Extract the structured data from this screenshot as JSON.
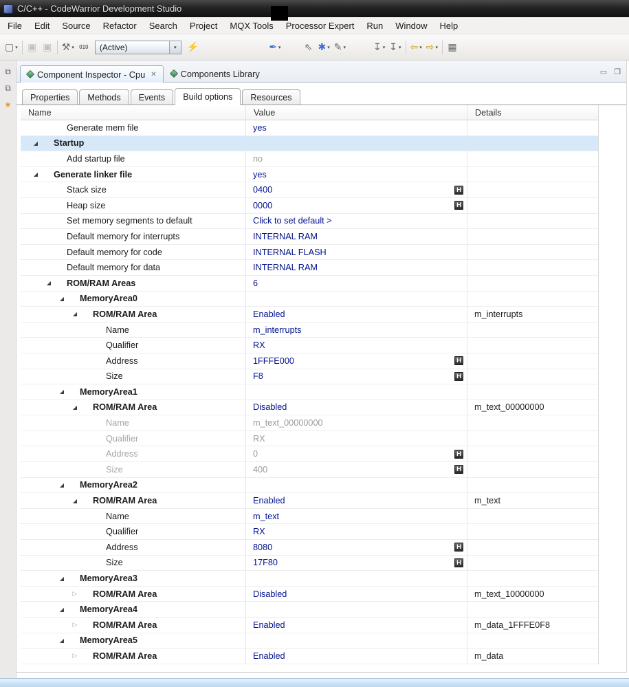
{
  "window": {
    "title": "C/C++ - CodeWarrior Development Studio"
  },
  "menu": {
    "items": [
      "File",
      "Edit",
      "Source",
      "Refactor",
      "Search",
      "Project",
      "MQX Tools",
      "Processor Expert",
      "Run",
      "Window",
      "Help"
    ]
  },
  "toolbar": {
    "active_combo": "(Active)",
    "caret_glyph": "▾",
    "items": [
      {
        "name": "new-wizard-button",
        "glyph": "▢",
        "caret": true
      },
      {
        "sep": true
      },
      {
        "name": "save-button",
        "glyph": "▣",
        "disabled": true
      },
      {
        "name": "save-all-button",
        "glyph": "▣",
        "disabled": true
      },
      {
        "sep": true
      },
      {
        "name": "build-settings-button",
        "glyph": "⚒",
        "caret": true
      },
      {
        "name": "binary-file-button",
        "glyph": "010",
        "small": true
      },
      {
        "name": "build-config-combo",
        "combo": true
      },
      {
        "name": "flash-programmer-button",
        "glyph": "⚡",
        "color": "#b8860b"
      },
      {
        "gap": 96
      },
      {
        "name": "debug-quill-button",
        "glyph": "✒",
        "color": "#3a6fd8",
        "caret": true
      },
      {
        "gap": 26
      },
      {
        "name": "select-tool-button",
        "glyph": "⇖"
      },
      {
        "name": "processor-expert-refresh-button",
        "glyph": "✱",
        "color": "#3a6fd8",
        "caret": true
      },
      {
        "name": "edit-pencil-button",
        "glyph": "✎",
        "caret": true
      },
      {
        "gap": 34
      },
      {
        "name": "run-to-line-button",
        "glyph": "↧",
        "caret": true
      },
      {
        "name": "instruction-step-button",
        "glyph": "↧",
        "caret": true
      },
      {
        "sep": true
      },
      {
        "name": "back-button",
        "glyph": "⇦",
        "color": "#c9a227",
        "caret": true
      },
      {
        "name": "forward-button",
        "glyph": "⇨",
        "color": "#c9a227",
        "caret": true
      },
      {
        "sep": true
      },
      {
        "name": "pin-editor-button",
        "glyph": "▦"
      }
    ]
  },
  "fastview": {
    "icons": [
      {
        "name": "restore-view-icon",
        "glyph": "⧉",
        "color": "#5a6b7c"
      },
      {
        "name": "open-perspective-icon",
        "glyph": "⧉",
        "color": "#5a6b7c"
      },
      {
        "name": "favorites-icon",
        "glyph": "★",
        "color": "#d9a23c"
      }
    ]
  },
  "editor": {
    "close_glyph": "✕",
    "tabs": [
      {
        "label": "Component Inspector - Cpu",
        "selected": true,
        "closable": true
      },
      {
        "label": "Components Library",
        "selected": false,
        "closable": false
      }
    ],
    "view_controls": [
      {
        "name": "minimize-view-icon",
        "glyph": "▭"
      },
      {
        "name": "restore-view-icon",
        "glyph": "❐"
      }
    ]
  },
  "subtabs": {
    "selected": "Build options",
    "tabs": [
      "Properties",
      "Methods",
      "Events",
      "Build options",
      "Resources"
    ]
  },
  "table": {
    "columns": [
      "Name",
      "Value",
      "Details"
    ],
    "hex_badge": "H",
    "rows": [
      {
        "name": "Generate mem file",
        "value": "yes",
        "details": "",
        "indent": 1,
        "arrow": "none"
      },
      {
        "name": "Startup",
        "value": "",
        "details": "",
        "indent": 0,
        "arrow": "open",
        "bold": true,
        "selected": true
      },
      {
        "name": "Add startup file",
        "value": "no",
        "details": "",
        "indent": 1,
        "arrow": "none",
        "valueGray": true
      },
      {
        "name": "Generate linker file",
        "value": "yes",
        "details": "",
        "indent": 0,
        "arrow": "open",
        "bold": true
      },
      {
        "name": "Stack size",
        "value": "0400",
        "details": "",
        "indent": 1,
        "arrow": "none",
        "hex": true
      },
      {
        "name": "Heap size",
        "value": "0000",
        "details": "",
        "indent": 1,
        "arrow": "none",
        "hex": true
      },
      {
        "name": "Set memory segments to default",
        "value": "Click to set default >",
        "details": "",
        "indent": 1,
        "arrow": "none"
      },
      {
        "name": "Default memory for interrupts",
        "value": "INTERNAL RAM",
        "details": "",
        "indent": 1,
        "arrow": "none"
      },
      {
        "name": "Default memory for code",
        "value": "INTERNAL FLASH",
        "details": "",
        "indent": 1,
        "arrow": "none"
      },
      {
        "name": "Default memory for data",
        "value": "INTERNAL RAM",
        "details": "",
        "indent": 1,
        "arrow": "none"
      },
      {
        "name": "ROM/RAM Areas",
        "value": "6",
        "details": "",
        "indent": 1,
        "arrow": "open",
        "bold": true
      },
      {
        "name": "MemoryArea0",
        "value": "",
        "details": "",
        "indent": 2,
        "arrow": "open",
        "bold": true
      },
      {
        "name": "ROM/RAM Area",
        "value": "Enabled",
        "details": "m_interrupts",
        "indent": 3,
        "arrow": "open",
        "bold": true
      },
      {
        "name": "Name",
        "value": "m_interrupts",
        "details": "",
        "indent": 4,
        "arrow": "none"
      },
      {
        "name": "Qualifier",
        "value": "RX",
        "details": "",
        "indent": 4,
        "arrow": "none"
      },
      {
        "name": "Address",
        "value": "1FFFE000",
        "details": "",
        "indent": 4,
        "arrow": "none",
        "hex": true
      },
      {
        "name": "Size",
        "value": "F8",
        "details": "",
        "indent": 4,
        "arrow": "none",
        "hex": true
      },
      {
        "name": "MemoryArea1",
        "value": "",
        "details": "",
        "indent": 2,
        "arrow": "open",
        "bold": true
      },
      {
        "name": "ROM/RAM Area",
        "value": "Disabled",
        "details": "m_text_00000000",
        "indent": 3,
        "arrow": "open",
        "bold": true
      },
      {
        "name": "Name",
        "value": "m_text_00000000",
        "details": "",
        "indent": 4,
        "arrow": "none",
        "nameGray": true,
        "valueGray": true
      },
      {
        "name": "Qualifier",
        "value": "RX",
        "details": "",
        "indent": 4,
        "arrow": "none",
        "nameGray": true,
        "valueGray": true
      },
      {
        "name": "Address",
        "value": "0",
        "details": "",
        "indent": 4,
        "arrow": "none",
        "hex": true,
        "nameGray": true,
        "valueGray": true
      },
      {
        "name": "Size",
        "value": "400",
        "details": "",
        "indent": 4,
        "arrow": "none",
        "hex": true,
        "nameGray": true,
        "valueGray": true
      },
      {
        "name": "MemoryArea2",
        "value": "",
        "details": "",
        "indent": 2,
        "arrow": "open",
        "bold": true
      },
      {
        "name": "ROM/RAM Area",
        "value": "Enabled",
        "details": "m_text",
        "indent": 3,
        "arrow": "open",
        "bold": true
      },
      {
        "name": "Name",
        "value": "m_text",
        "details": "",
        "indent": 4,
        "arrow": "none"
      },
      {
        "name": "Qualifier",
        "value": "RX",
        "details": "",
        "indent": 4,
        "arrow": "none"
      },
      {
        "name": "Address",
        "value": "8080",
        "details": "",
        "indent": 4,
        "arrow": "none",
        "hex": true
      },
      {
        "name": "Size",
        "value": "17F80",
        "details": "",
        "indent": 4,
        "arrow": "none",
        "hex": true
      },
      {
        "name": "MemoryArea3",
        "value": "",
        "details": "",
        "indent": 2,
        "arrow": "open",
        "bold": true
      },
      {
        "name": "ROM/RAM Area",
        "value": "Disabled",
        "details": "m_text_10000000",
        "indent": 3,
        "arrow": "closed",
        "bold": true
      },
      {
        "name": "MemoryArea4",
        "value": "",
        "details": "",
        "indent": 2,
        "arrow": "open",
        "bold": true
      },
      {
        "name": "ROM/RAM Area",
        "value": "Enabled",
        "details": "m_data_1FFFE0F8",
        "indent": 3,
        "arrow": "closed",
        "bold": true
      },
      {
        "name": "MemoryArea5",
        "value": "",
        "details": "",
        "indent": 2,
        "arrow": "open",
        "bold": true
      },
      {
        "name": "ROM/RAM Area",
        "value": "Enabled",
        "details": "m_data",
        "indent": 3,
        "arrow": "closed",
        "bold": true
      }
    ]
  },
  "colors": {
    "value_blue": "#02128e",
    "disabled_gray": "#9b9b9b",
    "selection_blue": "#d7e9f9",
    "title_bar": "#1a1a1a"
  }
}
